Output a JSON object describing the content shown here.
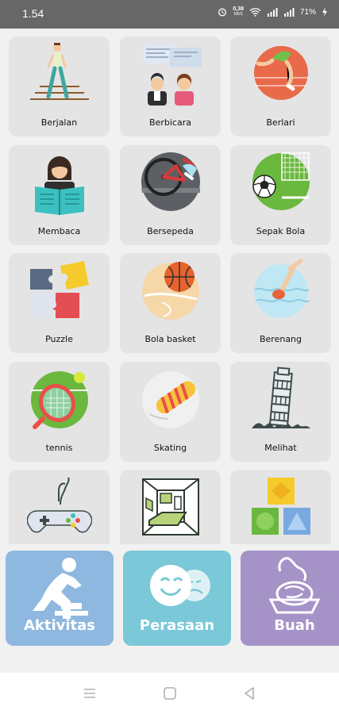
{
  "status_bar": {
    "time": "1.54",
    "net_speed_value": "0,38",
    "net_speed_unit": "KB/S",
    "battery": "71%"
  },
  "activities": [
    {
      "label": "Berjalan",
      "icon": "walking-icon"
    },
    {
      "label": "Berbicara",
      "icon": "talking-icon"
    },
    {
      "label": "Berlari",
      "icon": "running-icon"
    },
    {
      "label": "Membaca",
      "icon": "reading-icon"
    },
    {
      "label": "Bersepeda",
      "icon": "bicycle-icon"
    },
    {
      "label": "Sepak Bola",
      "icon": "soccer-icon"
    },
    {
      "label": "Puzzle",
      "icon": "puzzle-icon"
    },
    {
      "label": "Bola basket",
      "icon": "basketball-icon"
    },
    {
      "label": "Berenang",
      "icon": "swimming-icon"
    },
    {
      "label": "tennis",
      "icon": "tennis-icon"
    },
    {
      "label": "Skating",
      "icon": "skateboard-icon"
    },
    {
      "label": "Melihat",
      "icon": "tower-icon"
    },
    {
      "label": "",
      "icon": "gamepad-icon"
    },
    {
      "label": "",
      "icon": "room-icon"
    },
    {
      "label": "",
      "icon": "blocks-icon"
    }
  ],
  "categories": [
    {
      "label": "Aktivitas",
      "color": "#8fb8e0",
      "icon": "kneeling-person-icon"
    },
    {
      "label": "Perasaan",
      "color": "#7ac8d8",
      "icon": "faces-icon"
    },
    {
      "label": "Buah",
      "color": "#a593c7",
      "icon": "fruit-bowl-icon"
    }
  ],
  "nav": {
    "buttons": [
      "menu",
      "home",
      "back"
    ]
  }
}
